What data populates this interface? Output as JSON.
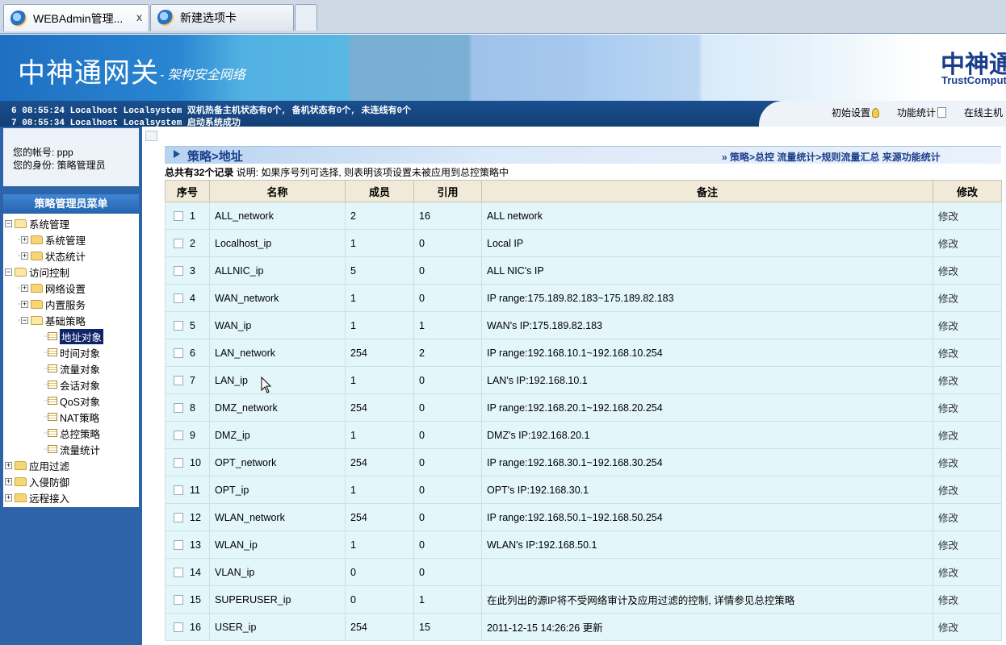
{
  "browser": {
    "tabs": [
      {
        "title": "WEBAdmin管理...",
        "close": "x"
      },
      {
        "title": "新建选项卡"
      }
    ]
  },
  "banner": {
    "title": "中神通网关",
    "slogan": "- 架构安全网络",
    "logo_cn": "中神通",
    "logo_en": "TrustComputing"
  },
  "log": {
    "lines": [
      "6 08:55:24 Localhost Localsystem 双机热备主机状态有0个, 备机状态有0个, 未连线有0个",
      "7 08:55:34 Localhost Localsystem 启动系统成功"
    ]
  },
  "toplinks": [
    "初始设置",
    "功能统计",
    "在线主机"
  ],
  "account": {
    "line1": "您的帐号: ppp",
    "line2": "您的身份: 策略管理员"
  },
  "menu": {
    "header": "策略管理员菜单",
    "nodes": [
      {
        "label": "系统管理",
        "level": 0,
        "type": "folder",
        "expanded": true
      },
      {
        "label": "系统管理",
        "level": 1,
        "type": "folder",
        "expanded": false
      },
      {
        "label": "状态统计",
        "level": 1,
        "type": "folder",
        "expanded": false
      },
      {
        "label": "访问控制",
        "level": 0,
        "type": "folder",
        "expanded": true
      },
      {
        "label": "网络设置",
        "level": 1,
        "type": "folder",
        "expanded": false
      },
      {
        "label": "内置服务",
        "level": 1,
        "type": "folder",
        "expanded": false
      },
      {
        "label": "基础策略",
        "level": 1,
        "type": "folder",
        "expanded": true
      },
      {
        "label": "地址对象",
        "level": 2,
        "type": "leaf",
        "selected": true
      },
      {
        "label": "时间对象",
        "level": 2,
        "type": "leaf"
      },
      {
        "label": "流量对象",
        "level": 2,
        "type": "leaf"
      },
      {
        "label": "会话对象",
        "level": 2,
        "type": "leaf"
      },
      {
        "label": "QoS对象",
        "level": 2,
        "type": "leaf"
      },
      {
        "label": "NAT策略",
        "level": 2,
        "type": "leaf"
      },
      {
        "label": "总控策略",
        "level": 2,
        "type": "leaf"
      },
      {
        "label": "流量统计",
        "level": 2,
        "type": "leaf"
      },
      {
        "label": "应用过滤",
        "level": 0,
        "type": "folder",
        "expanded": false
      },
      {
        "label": "入侵防御",
        "level": 0,
        "type": "folder",
        "expanded": false
      },
      {
        "label": "远程接入",
        "level": 0,
        "type": "folder",
        "expanded": false
      }
    ]
  },
  "page": {
    "title": "策略>地址",
    "quicklinks": "» 策略>总控 流量统计>规则流量汇总 来源功能统计",
    "summary_bold": "总共有32个记录",
    "summary_note": " 说明: 如果序号列可选择, 则表明该项设置未被应用到总控策略中"
  },
  "table": {
    "headers": [
      "序号",
      "名称",
      "成员",
      "引用",
      "备注",
      "修改"
    ],
    "rows": [
      [
        "1",
        "ALL_network",
        "2",
        "16",
        "ALL network",
        "修改"
      ],
      [
        "2",
        "Localhost_ip",
        "1",
        "0",
        "Local IP",
        "修改"
      ],
      [
        "3",
        "ALLNIC_ip",
        "5",
        "0",
        "ALL NIC's IP",
        "修改"
      ],
      [
        "4",
        "WAN_network",
        "1",
        "0",
        "IP range:175.189.82.183~175.189.82.183",
        "修改"
      ],
      [
        "5",
        "WAN_ip",
        "1",
        "1",
        "WAN's IP:175.189.82.183",
        "修改"
      ],
      [
        "6",
        "LAN_network",
        "254",
        "2",
        "IP range:192.168.10.1~192.168.10.254",
        "修改"
      ],
      [
        "7",
        "LAN_ip",
        "1",
        "0",
        "LAN's IP:192.168.10.1",
        "修改"
      ],
      [
        "8",
        "DMZ_network",
        "254",
        "0",
        "IP range:192.168.20.1~192.168.20.254",
        "修改"
      ],
      [
        "9",
        "DMZ_ip",
        "1",
        "0",
        "DMZ's IP:192.168.20.1",
        "修改"
      ],
      [
        "10",
        "OPT_network",
        "254",
        "0",
        "IP range:192.168.30.1~192.168.30.254",
        "修改"
      ],
      [
        "11",
        "OPT_ip",
        "1",
        "0",
        "OPT's IP:192.168.30.1",
        "修改"
      ],
      [
        "12",
        "WLAN_network",
        "254",
        "0",
        "IP range:192.168.50.1~192.168.50.254",
        "修改"
      ],
      [
        "13",
        "WLAN_ip",
        "1",
        "0",
        "WLAN's IP:192.168.50.1",
        "修改"
      ],
      [
        "14",
        "VLAN_ip",
        "0",
        "0",
        "",
        "修改"
      ],
      [
        "15",
        "SUPERUSER_ip",
        "0",
        "1",
        "在此列出的源IP将不受网络审计及应用过滤的控制, 详情参见总控策略",
        "修改"
      ],
      [
        "16",
        "USER_ip",
        "254",
        "15",
        "2011-12-15 14:26:26 更新",
        "修改"
      ]
    ]
  },
  "colors": {
    "banner_blue": "#1e6fc1",
    "sidebar_blue": "#2d63a8",
    "row_bg": "#e3f6f9",
    "header_bg": "#f1ead8",
    "title_blue": "#1b3e8c"
  }
}
